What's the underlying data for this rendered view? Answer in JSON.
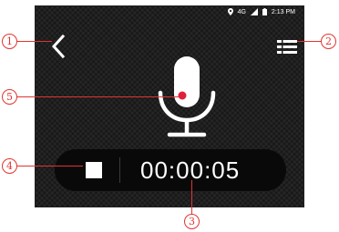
{
  "status_bar": {
    "network_label": "4G",
    "time": "2:13 PM"
  },
  "recorder": {
    "timer": "00:00:05"
  },
  "icons": {
    "back": "chevron-left-icon",
    "menu": "menu-icon",
    "microphone": "microphone-icon",
    "stop": "stop-icon",
    "location": "location-pin-icon",
    "signal": "signal-icon",
    "battery": "battery-icon"
  },
  "callouts": [
    "1",
    "2",
    "3",
    "4",
    "5"
  ],
  "colors": {
    "callout": "#e0352f",
    "record_dot": "#e0203a",
    "screen_bg": "#1f1f1f"
  }
}
